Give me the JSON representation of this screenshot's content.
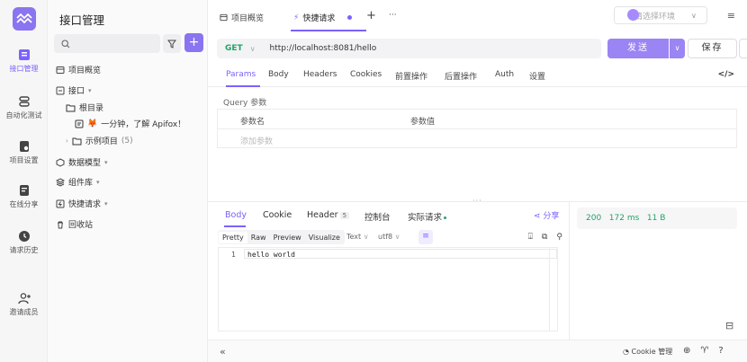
{
  "rail": {
    "items": [
      {
        "label": "接口管理",
        "icon": "api-icon"
      },
      {
        "label": "自动化测试",
        "icon": "automation-icon"
      },
      {
        "label": "项目设置",
        "icon": "settings-icon"
      },
      {
        "label": "在线分享",
        "icon": "share-icon"
      },
      {
        "label": "请求历史",
        "icon": "history-icon"
      },
      {
        "label": "邀请成员",
        "icon": "invite-icon"
      }
    ]
  },
  "sidebar": {
    "title": "接口管理",
    "tree": {
      "overview": "项目概览",
      "api": "接口",
      "root": "根目录",
      "intro_emoji": "🦊",
      "intro": "一分钟，了解 Apifox！",
      "example": "示例项目",
      "example_count": "(5)",
      "schemas": "数据模型",
      "components": "组件库",
      "quick": "快捷请求",
      "recycle": "回收站"
    }
  },
  "tabs": {
    "overview": "项目概览",
    "quick": "快捷请求",
    "add": "+",
    "more": "···"
  },
  "env": {
    "placeholder": "请选择环境"
  },
  "request": {
    "method": "GET",
    "url": "http://localhost:8081/hello",
    "send": "发送",
    "save": "保存",
    "tabs": [
      "Params",
      "Body",
      "Headers",
      "Cookies",
      "前置操作",
      "后置操作",
      "Auth",
      "设置"
    ],
    "code_icon": "</>",
    "query_label": "Query 参数",
    "col_name": "参数名",
    "col_value": "参数值",
    "add_param": "添加参数"
  },
  "response": {
    "tabs": {
      "body": "Body",
      "cookie": "Cookie",
      "header": "Header",
      "header_count": "5",
      "console": "控制台",
      "actual": "实际请求"
    },
    "share": "分享",
    "formats": [
      "Pretty",
      "Raw",
      "Preview",
      "Visualize"
    ],
    "format_type": "Text",
    "encoding": "utf8",
    "code": [
      {
        "line": "1",
        "text": "hello world"
      }
    ],
    "status_code": "200",
    "time": "172 ms",
    "size": "11 B"
  },
  "footer": {
    "collapse": "«",
    "cookie_manager": "Cookie 管理"
  },
  "colors": {
    "accent": "#7b61ff",
    "success": "#21a366"
  }
}
